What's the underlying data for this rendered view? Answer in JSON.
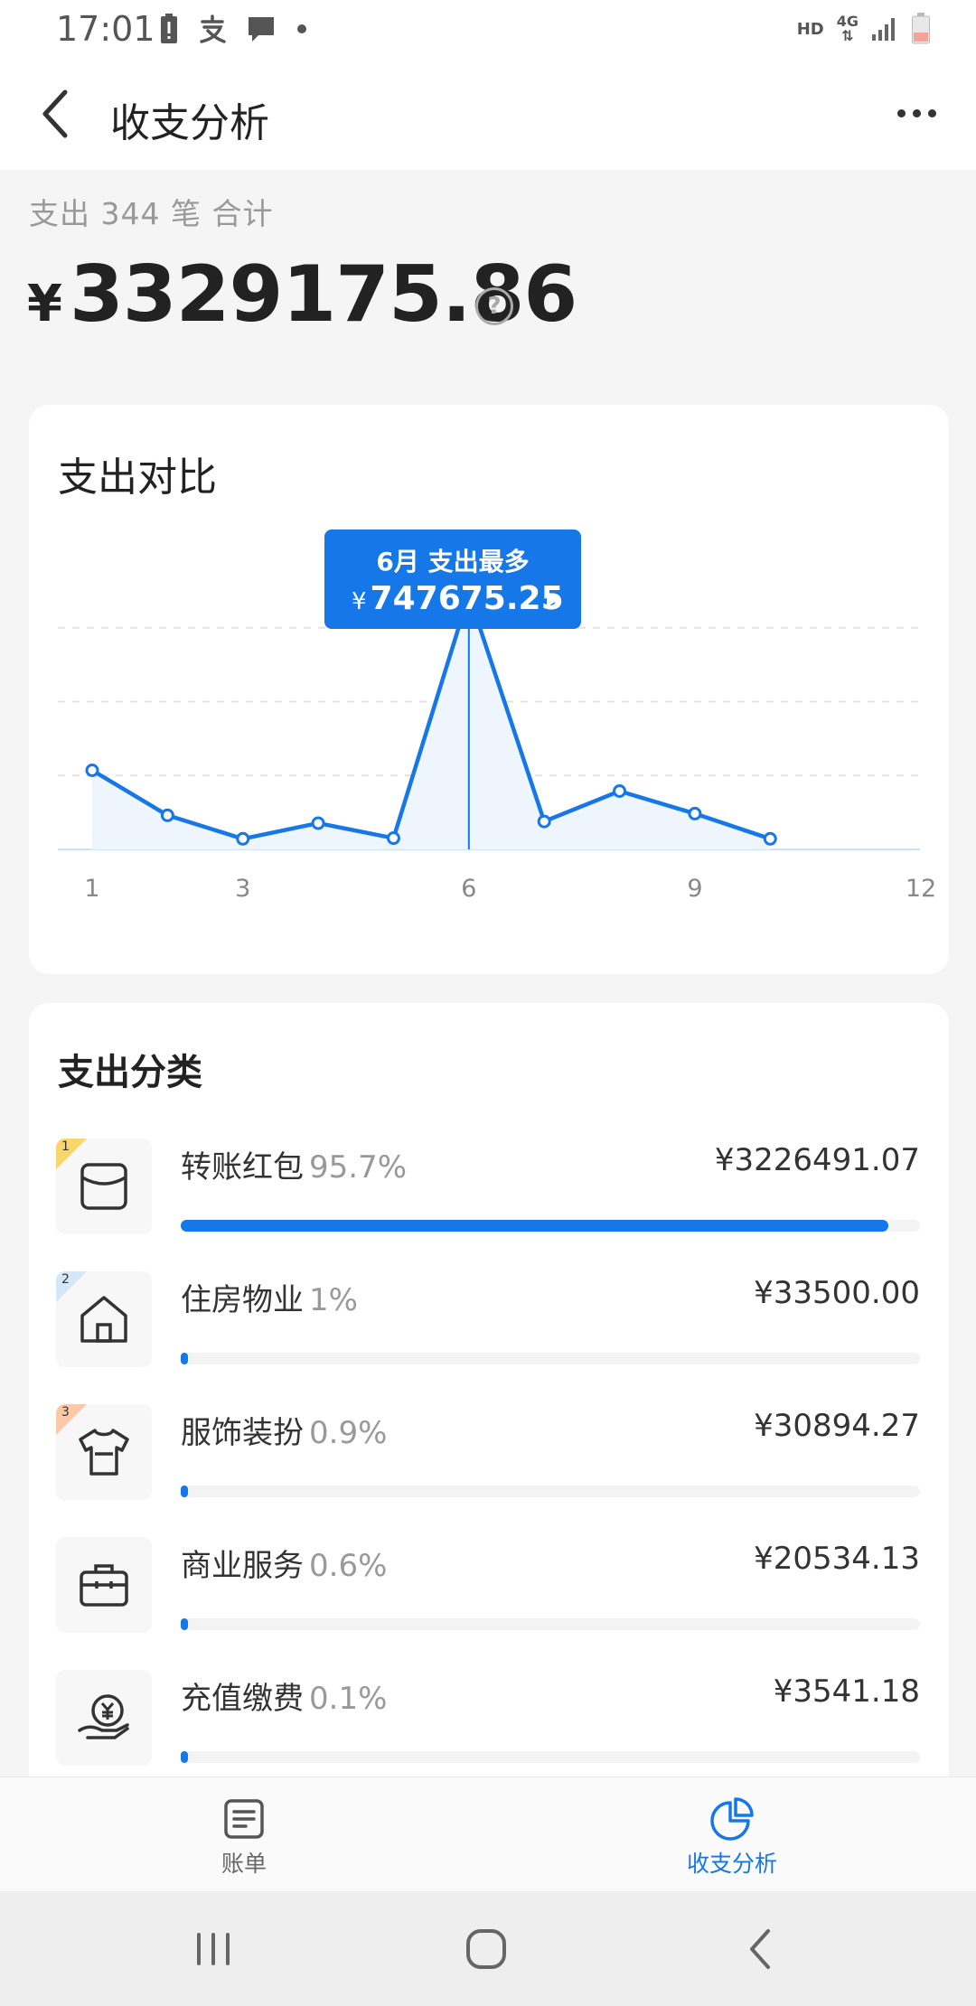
{
  "status_bar": {
    "time": "17:01",
    "left_icons": [
      "battery-alert-icon",
      "alipay-icon",
      "message-icon",
      "dot-icon"
    ],
    "hd": "HD",
    "network": "4G"
  },
  "nav": {
    "title": "收支分析"
  },
  "summary": {
    "label": "支出 344 笔 合计",
    "currency": "¥",
    "total": "3329175.86"
  },
  "trend_card": {
    "title": "支出对比",
    "tooltip": {
      "title": "6月 支出最多",
      "currency": "¥",
      "value": "747675.25"
    }
  },
  "chart_data": {
    "type": "line",
    "x": [
      1,
      2,
      3,
      4,
      5,
      6,
      7,
      8,
      9,
      10
    ],
    "values": [
      232000,
      100000,
      31000,
      77000,
      33000,
      747675.25,
      82000,
      171000,
      105000,
      31000
    ],
    "xlim": [
      1,
      12
    ],
    "x_ticks": [
      "1",
      "3",
      "6",
      "9",
      "12"
    ],
    "highlight_index": 5,
    "grid": true,
    "color": "#1677e8",
    "fill": "#eef5fd"
  },
  "category_card": {
    "title": "支出分类",
    "items": [
      {
        "rank": "1",
        "rank_color": "#f9d66b",
        "icon": "red-packet-icon",
        "name": "转账红包",
        "pct": "95.7%",
        "amount": "¥3226491.07",
        "share": 0.957
      },
      {
        "rank": "2",
        "rank_color": "#d5e8f8",
        "icon": "house-icon",
        "name": "住房物业",
        "pct": "1%",
        "amount": "¥33500.00",
        "share": 0.01
      },
      {
        "rank": "3",
        "rank_color": "#fbc9a8",
        "icon": "tshirt-icon",
        "name": "服饰装扮",
        "pct": "0.9%",
        "amount": "¥30894.27",
        "share": 0.009
      },
      {
        "rank": "",
        "rank_color": "",
        "icon": "briefcase-icon",
        "name": "商业服务",
        "pct": "0.6%",
        "amount": "¥20534.13",
        "share": 0.006
      },
      {
        "rank": "",
        "rank_color": "",
        "icon": "recharge-coin-icon",
        "name": "充值缴费",
        "pct": "0.1%",
        "amount": "¥3541.18",
        "share": 0.001
      }
    ]
  },
  "bottom_tabs": [
    {
      "label": "账单",
      "active": false
    },
    {
      "label": "收支分析",
      "active": true
    }
  ],
  "colors": {
    "accent": "#1677e8",
    "background": "#f5f5f5"
  }
}
